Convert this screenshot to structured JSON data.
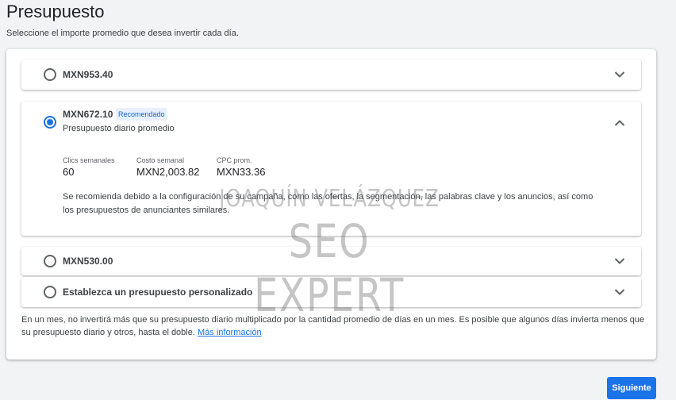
{
  "header": {
    "title": "Presupuesto",
    "subtitle": "Seleccione el importe promedio que desea invertir cada día."
  },
  "options": [
    {
      "label": "MXN953.40",
      "selected": false,
      "expanded": false
    },
    {
      "label": "MXN672.10",
      "selected": true,
      "expanded": true,
      "badge": "Recomendado",
      "sublabel": "Presupuesto diario promedio",
      "metrics": [
        {
          "label": "Clics semanales",
          "value": "60"
        },
        {
          "label": "Costo semanal",
          "value": "MXN2,003.82"
        },
        {
          "label": "CPC prom.",
          "value": "MXN33.36"
        }
      ],
      "description": "Se recomienda debido a la configuración de su campaña, como las ofertas, la segmentación, las palabras clave y los anuncios, así como los presupuestos de anunciantes similares."
    },
    {
      "label": "MXN530.00",
      "selected": false,
      "expanded": false
    },
    {
      "label": "Establezca un presupuesto personalizado",
      "selected": false,
      "expanded": false
    }
  ],
  "footer": {
    "note": "En un mes, no invertirá más que su presupuesto diario multiplicado por la cantidad promedio de días en un mes. Es posible que algunos días invierta menos que su presupuesto diario y otros, hasta el doble.",
    "link": "Más información"
  },
  "actions": {
    "next_label": "Siguiente"
  },
  "watermark": {
    "line1": "JOAQUÍN VELÁZQUEZ",
    "line2": "SEO EXPERT"
  },
  "colors": {
    "accent": "#1a73e8",
    "badge_bg": "#e8f0fe",
    "page_bg": "#f1f3f4"
  },
  "icons": {
    "collapsed": "chevron-down-icon",
    "expanded": "chevron-up-icon"
  }
}
